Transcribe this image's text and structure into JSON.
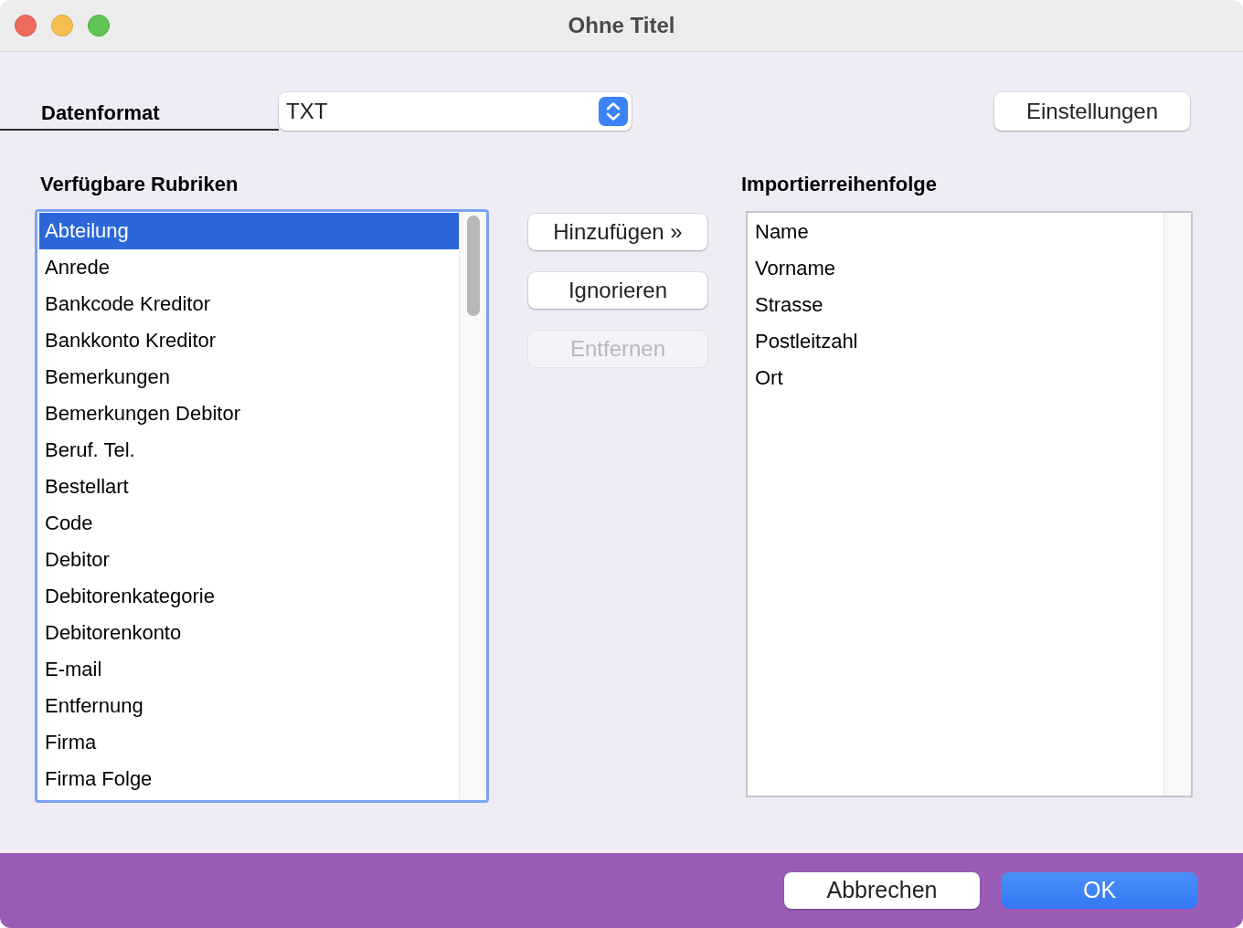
{
  "window": {
    "title": "Ohne Titel"
  },
  "format": {
    "label": "Datenformat",
    "value": "TXT"
  },
  "settings_button": {
    "label": "Einstellungen"
  },
  "available": {
    "heading": "Verfügbare Rubriken",
    "focused": true,
    "items": [
      {
        "label": "Abteilung",
        "selected": true
      },
      {
        "label": "Anrede",
        "selected": false
      },
      {
        "label": "Bankcode Kreditor",
        "selected": false
      },
      {
        "label": "Bankkonto Kreditor",
        "selected": false
      },
      {
        "label": "Bemerkungen",
        "selected": false
      },
      {
        "label": "Bemerkungen Debitor",
        "selected": false
      },
      {
        "label": "Beruf. Tel.",
        "selected": false
      },
      {
        "label": "Bestellart",
        "selected": false
      },
      {
        "label": "Code",
        "selected": false
      },
      {
        "label": "Debitor",
        "selected": false
      },
      {
        "label": "Debitorenkategorie",
        "selected": false
      },
      {
        "label": "Debitorenkonto",
        "selected": false
      },
      {
        "label": "E-mail",
        "selected": false
      },
      {
        "label": "Entfernung",
        "selected": false
      },
      {
        "label": "Firma",
        "selected": false
      },
      {
        "label": "Firma Folge",
        "selected": false
      }
    ]
  },
  "actions": [
    {
      "label": "Hinzufügen »",
      "disabled": false
    },
    {
      "label": "Ignorieren",
      "disabled": false
    },
    {
      "label": "Entfernen",
      "disabled": true
    }
  ],
  "order": {
    "heading": "Importierreihenfolge",
    "focused": false,
    "items": [
      {
        "label": "Name",
        "selected": false
      },
      {
        "label": "Vorname",
        "selected": false
      },
      {
        "label": "Strasse",
        "selected": false
      },
      {
        "label": "Postleitzahl",
        "selected": false
      },
      {
        "label": "Ort",
        "selected": false
      }
    ]
  },
  "footer_buttons": [
    {
      "label": "Abbrechen",
      "kind": "default"
    },
    {
      "label": "OK",
      "kind": "primary"
    }
  ]
}
